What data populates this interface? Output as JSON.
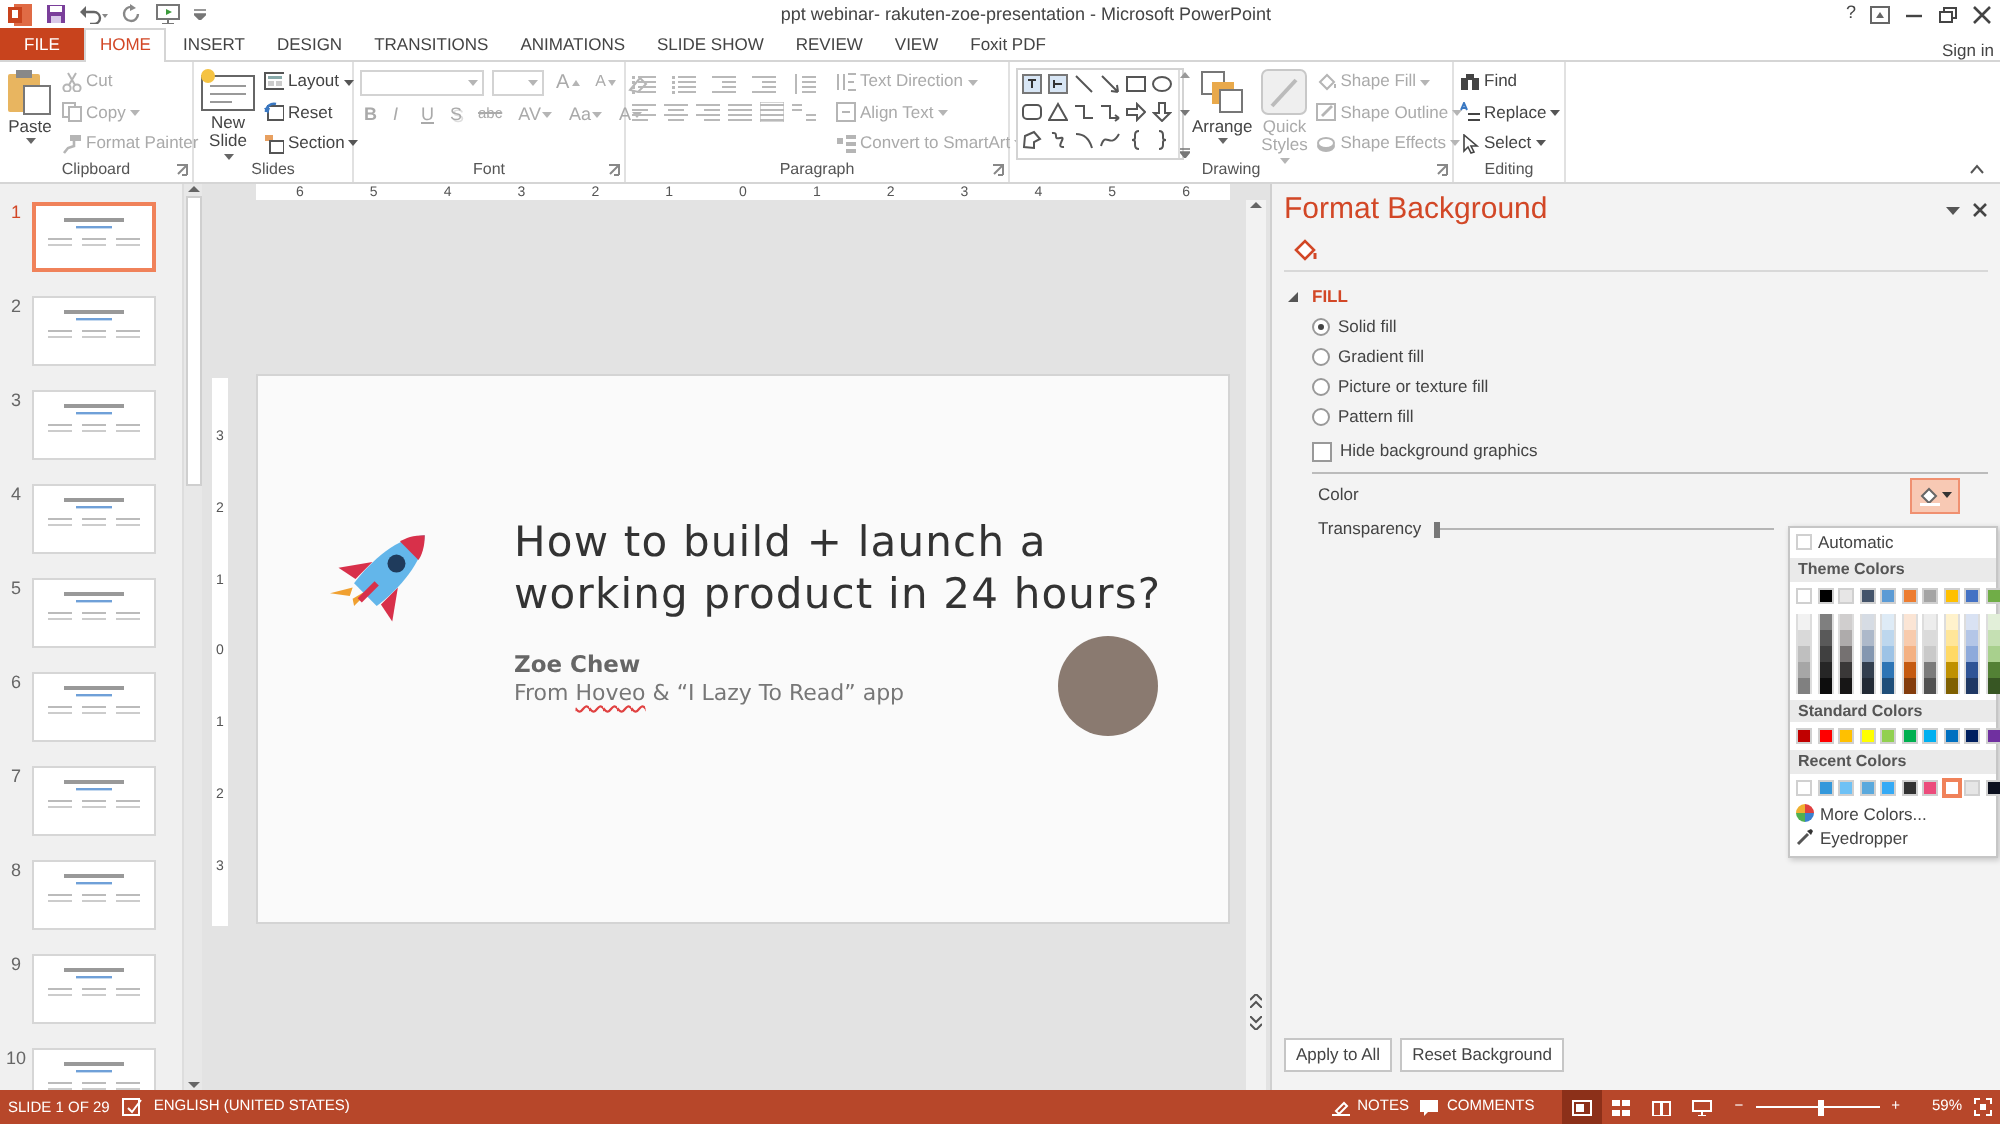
{
  "title_bar": {
    "title": "ppt webinar- rakuten-zoe-presentation - Microsoft PowerPoint",
    "help": "?"
  },
  "tabs": [
    {
      "label": "FILE",
      "kind": "file",
      "selected": false
    },
    {
      "label": "HOME",
      "kind": "tab",
      "selected": true
    },
    {
      "label": "INSERT",
      "kind": "tab",
      "selected": false
    },
    {
      "label": "DESIGN",
      "kind": "tab",
      "selected": false
    },
    {
      "label": "TRANSITIONS",
      "kind": "tab",
      "selected": false
    },
    {
      "label": "ANIMATIONS",
      "kind": "tab",
      "selected": false
    },
    {
      "label": "SLIDE SHOW",
      "kind": "tab",
      "selected": false
    },
    {
      "label": "REVIEW",
      "kind": "tab",
      "selected": false
    },
    {
      "label": "VIEW",
      "kind": "tab",
      "selected": false
    },
    {
      "label": "Foxit PDF",
      "kind": "tab",
      "selected": false
    }
  ],
  "sign_in": "Sign in",
  "ribbon": [
    {
      "kind": "clipboard",
      "label": "Clipboard",
      "large": [
        {
          "label": "Paste",
          "disabled": false
        }
      ],
      "small": [
        {
          "label": "Cut",
          "disabled": true,
          "dropdown": false
        },
        {
          "label": "Copy",
          "disabled": true,
          "dropdown": true
        },
        {
          "label": "Format Painter",
          "disabled": true,
          "dropdown": false
        }
      ]
    },
    {
      "kind": "slides",
      "label": "Slides",
      "large": [
        {
          "label": "New Slide",
          "disabled": false
        }
      ],
      "small": [
        {
          "label": "Layout",
          "disabled": false,
          "dropdown": true
        },
        {
          "label": "Reset",
          "disabled": false,
          "dropdown": false
        },
        {
          "label": "Section",
          "disabled": false,
          "dropdown": true
        }
      ]
    },
    {
      "kind": "font",
      "label": "Font",
      "disabled": true,
      "size_buttons": [
        "A",
        "A"
      ],
      "buttons": [
        "B",
        "I",
        "U",
        "S",
        "abc",
        "AV",
        "Aa",
        "A"
      ]
    },
    {
      "kind": "paragraph",
      "label": "Paragraph",
      "disabled": true,
      "small": [
        {
          "label": "Text Direction",
          "disabled": true,
          "dropdown": true
        },
        {
          "label": "Align Text",
          "disabled": true,
          "dropdown": true
        },
        {
          "label": "Convert to SmartArt",
          "disabled": true,
          "dropdown": true
        }
      ]
    },
    {
      "kind": "drawing",
      "label": "Drawing",
      "large": [
        {
          "label": "Arrange",
          "disabled": false
        },
        {
          "label": "Quick Styles",
          "disabled": true
        }
      ],
      "small": [
        {
          "label": "Shape Fill",
          "disabled": true,
          "dropdown": true
        },
        {
          "label": "Shape Outline",
          "disabled": true,
          "dropdown": true
        },
        {
          "label": "Shape Effects",
          "disabled": true,
          "dropdown": true
        }
      ]
    },
    {
      "kind": "editing",
      "label": "Editing",
      "small": [
        {
          "label": "Find",
          "disabled": false,
          "dropdown": false
        },
        {
          "label": "Replace",
          "disabled": false,
          "dropdown": true
        },
        {
          "label": "Select",
          "disabled": false,
          "dropdown": true
        }
      ]
    }
  ],
  "thumbnails": [
    {
      "number": "1",
      "selected": true
    },
    {
      "number": "2",
      "selected": false
    },
    {
      "number": "3",
      "selected": false
    },
    {
      "number": "4",
      "selected": false
    },
    {
      "number": "5",
      "selected": false
    },
    {
      "number": "6",
      "selected": false
    },
    {
      "number": "7",
      "selected": false
    },
    {
      "number": "8",
      "selected": false
    },
    {
      "number": "9",
      "selected": false
    },
    {
      "number": "10",
      "selected": false
    }
  ],
  "rulers": {
    "horizontal": [
      "6",
      "5",
      "4",
      "3",
      "2",
      "1",
      "0",
      "1",
      "2",
      "3",
      "4",
      "5",
      "6"
    ],
    "vertical": [
      "3",
      "2",
      "1",
      "0",
      "1",
      "2",
      "3"
    ]
  },
  "slide": {
    "title": "How to build + launch a working product in 24 hours?",
    "author": "Zoe Chew",
    "byline": [
      {
        "text": "From ",
        "misspelled": false
      },
      {
        "text": "Hoveo",
        "misspelled": true
      },
      {
        "text": " & “I Lazy To Read” app",
        "misspelled": false
      }
    ]
  },
  "format_panel": {
    "title": "Format Background",
    "section": {
      "label": "FILL",
      "expanded": true
    },
    "fill_options": [
      {
        "label": "Solid fill",
        "selected": true
      },
      {
        "label": "Gradient fill",
        "selected": false
      },
      {
        "label": "Picture or texture fill",
        "selected": false
      },
      {
        "label": "Pattern fill",
        "selected": false
      }
    ],
    "hide_graphics": {
      "label": "Hide background graphics",
      "checked": false
    },
    "color": {
      "label": "Color",
      "open": true
    },
    "transparency": {
      "label": "Transparency",
      "level": 0
    },
    "buttons": [
      "Apply to All",
      "Reset Background"
    ]
  },
  "color_picker": {
    "automatic": "Automatic",
    "theme_header": "Theme Colors",
    "theme_colors": [
      {
        "color": "#ffffff",
        "shades": [
          {
            "color": "#f2f2f2"
          },
          {
            "color": "#d9d9d9"
          },
          {
            "color": "#bfbfbf"
          },
          {
            "color": "#a6a6a6"
          },
          {
            "color": "#808080"
          }
        ]
      },
      {
        "color": "#000000",
        "shades": [
          {
            "color": "#7f7f7f"
          },
          {
            "color": "#595959"
          },
          {
            "color": "#404040"
          },
          {
            "color": "#262626"
          },
          {
            "color": "#0d0d0d"
          }
        ]
      },
      {
        "color": "#e7e6e6",
        "shades": [
          {
            "color": "#d0cece"
          },
          {
            "color": "#aeabab"
          },
          {
            "color": "#757171"
          },
          {
            "color": "#3a3838"
          },
          {
            "color": "#171616"
          }
        ]
      },
      {
        "color": "#44546a",
        "shades": [
          {
            "color": "#d6dce4"
          },
          {
            "color": "#adb9ca"
          },
          {
            "color": "#8497b0"
          },
          {
            "color": "#333f4f"
          },
          {
            "color": "#222a35"
          }
        ]
      },
      {
        "color": "#5b9bd5",
        "shades": [
          {
            "color": "#deebf6"
          },
          {
            "color": "#bdd7ee"
          },
          {
            "color": "#9dc3e6"
          },
          {
            "color": "#2e75b5"
          },
          {
            "color": "#1f4e79"
          }
        ]
      },
      {
        "color": "#ed7d31",
        "shades": [
          {
            "color": "#fbe5d5"
          },
          {
            "color": "#f8cbad"
          },
          {
            "color": "#f4b183"
          },
          {
            "color": "#c55a11"
          },
          {
            "color": "#843c0c"
          }
        ]
      },
      {
        "color": "#a5a5a5",
        "shades": [
          {
            "color": "#ededed"
          },
          {
            "color": "#dbdbdb"
          },
          {
            "color": "#c9c9c9"
          },
          {
            "color": "#7b7b7b"
          },
          {
            "color": "#525252"
          }
        ]
      },
      {
        "color": "#ffc000",
        "shades": [
          {
            "color": "#fff2cc"
          },
          {
            "color": "#ffe699"
          },
          {
            "color": "#ffd965"
          },
          {
            "color": "#bf9000"
          },
          {
            "color": "#7f6000"
          }
        ]
      },
      {
        "color": "#4472c4",
        "shades": [
          {
            "color": "#d9e2f3"
          },
          {
            "color": "#b4c6e7"
          },
          {
            "color": "#8eaadb"
          },
          {
            "color": "#2f5496"
          },
          {
            "color": "#1f3864"
          }
        ]
      },
      {
        "color": "#70ad47",
        "shades": [
          {
            "color": "#e2efd9"
          },
          {
            "color": "#c5e0b3"
          },
          {
            "color": "#a8d08d"
          },
          {
            "color": "#538135"
          },
          {
            "color": "#375623"
          }
        ]
      }
    ],
    "standard_header": "Standard Colors",
    "standard_colors": [
      {
        "color": "#c00000"
      },
      {
        "color": "#ff0000"
      },
      {
        "color": "#ffc000"
      },
      {
        "color": "#ffff00"
      },
      {
        "color": "#92d050"
      },
      {
        "color": "#00b050"
      },
      {
        "color": "#00b0f0"
      },
      {
        "color": "#0070c0"
      },
      {
        "color": "#002060"
      },
      {
        "color": "#7030a0"
      }
    ],
    "recent_header": "Recent Colors",
    "recent_colors": [
      {
        "color": "#ffffff",
        "selected": false
      },
      {
        "color": "#3498db",
        "selected": false
      },
      {
        "color": "#6ec1f5",
        "selected": false
      },
      {
        "color": "#5aa9dd",
        "selected": false
      },
      {
        "color": "#35aaf5",
        "selected": false
      },
      {
        "color": "#333333",
        "selected": false
      },
      {
        "color": "#ec4c7c",
        "selected": false
      },
      {
        "color": "#ffffff",
        "selected": true
      },
      {
        "color": "#e6e6e6",
        "selected": false
      },
      {
        "color": "#0b0f1e",
        "selected": false
      }
    ],
    "more_colors": "More Colors...",
    "eyedropper": "Eyedropper"
  },
  "status_bar": {
    "slide_info": "SLIDE 1 OF 29",
    "language": "ENGLISH (UNITED STATES)",
    "notes": "NOTES",
    "comments": "COMMENTS",
    "views": [
      {
        "selected": true
      },
      {
        "selected": false
      },
      {
        "selected": false
      },
      {
        "selected": false
      }
    ],
    "zoom": {
      "minus": "−",
      "plus": "+",
      "level": 0.5,
      "reading": "59%"
    }
  }
}
